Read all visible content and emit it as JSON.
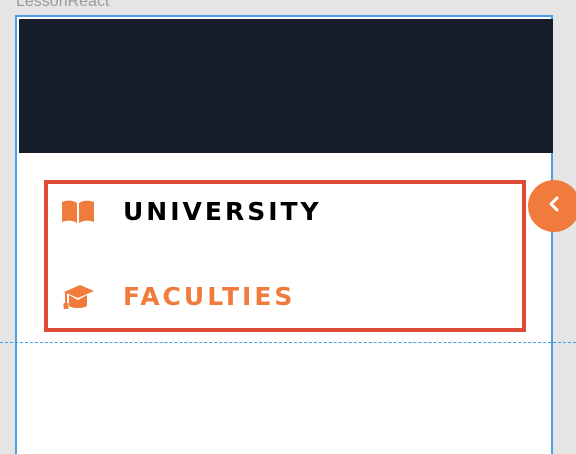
{
  "window": {
    "title": "LessonReact"
  },
  "menu": {
    "items": [
      {
        "label": "UNIVERSITY",
        "icon": "book-open-icon",
        "color": "#000000"
      },
      {
        "label": "FACULTIES",
        "icon": "graduation-cap-icon",
        "color": "#f07b3c"
      }
    ]
  },
  "toggle": {
    "icon": "chevron-left-icon"
  },
  "colors": {
    "header": "#171d2a",
    "accent": "#f07b3c",
    "highlight_border": "#e04b35",
    "selection_frame": "#4a9ee8"
  }
}
